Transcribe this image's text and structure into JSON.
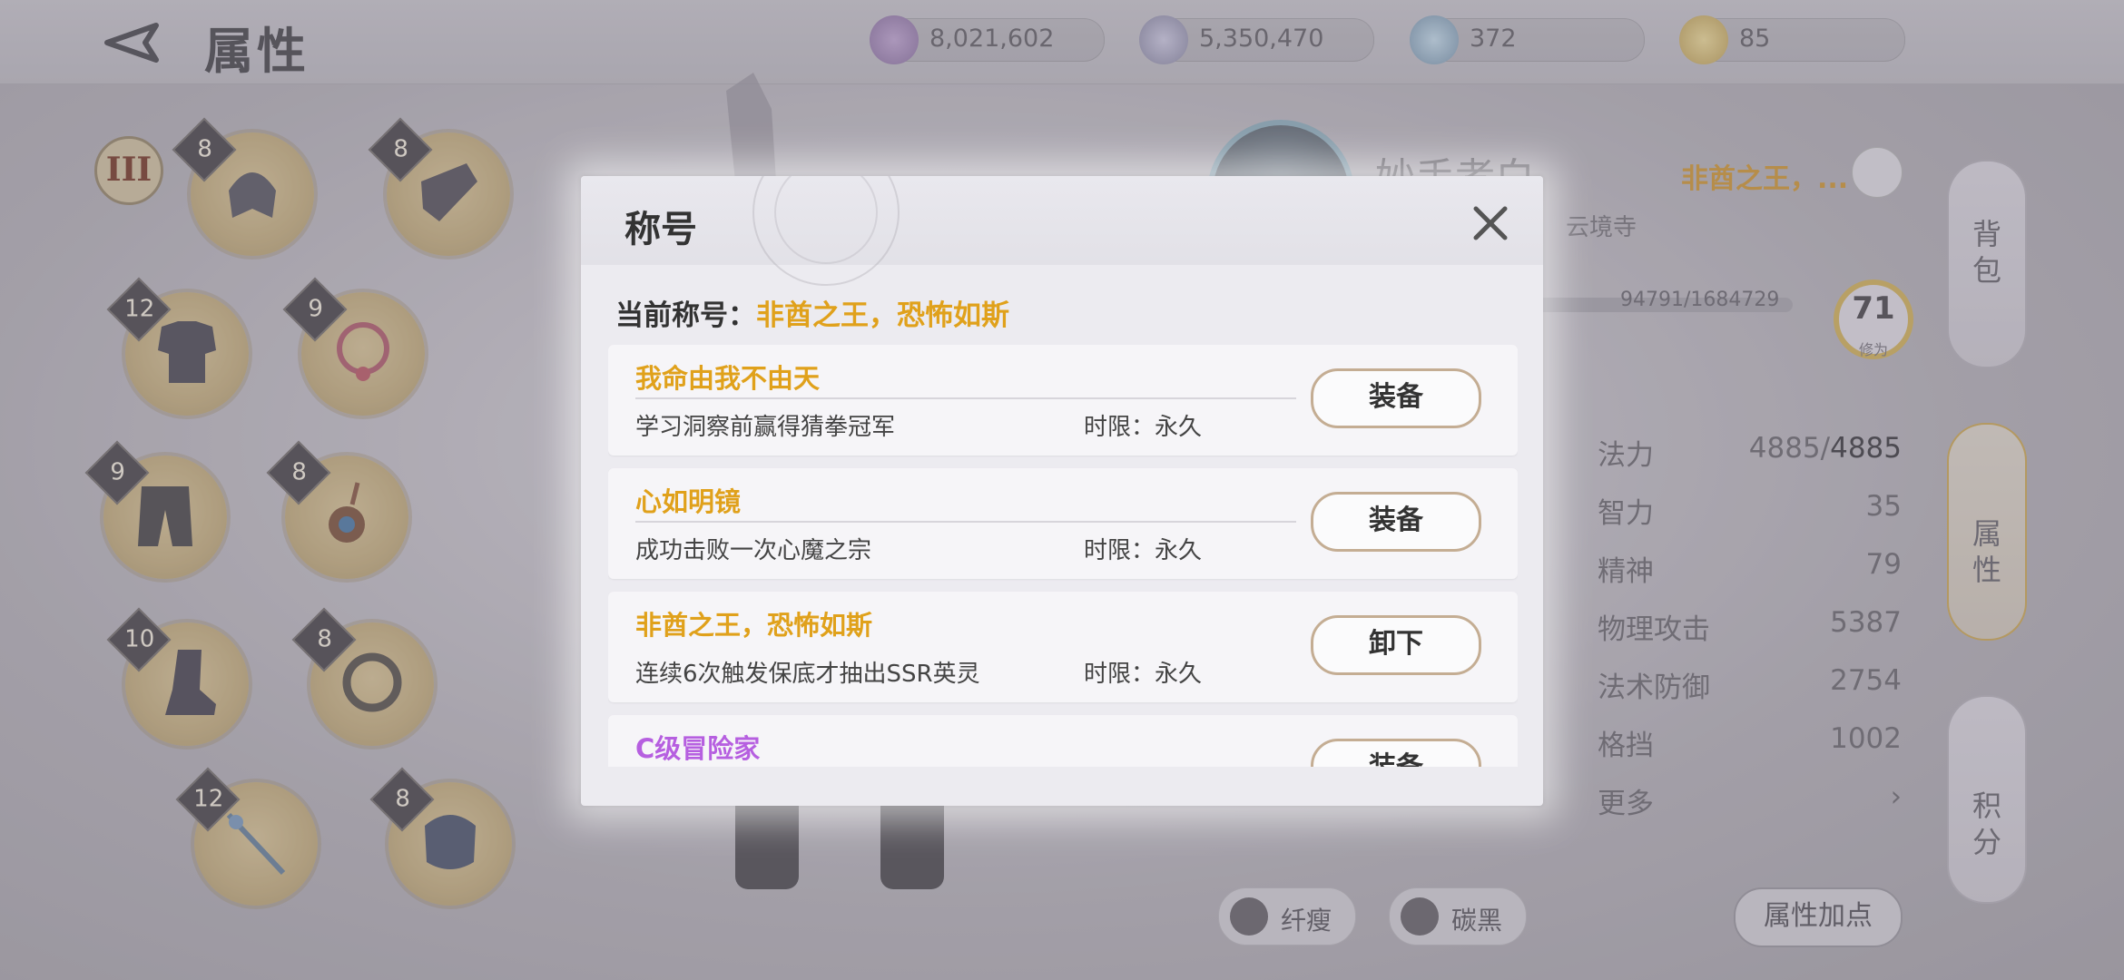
{
  "header": {
    "title": "属性"
  },
  "currencies": [
    {
      "icon": "purple-crystal-icon",
      "value": "8,021,602"
    },
    {
      "icon": "silver-coin-icon",
      "value": "5,350,470"
    },
    {
      "icon": "blue-gem-icon",
      "value": "372"
    },
    {
      "icon": "gold-medal-icon",
      "value": "85"
    }
  ],
  "equipment": {
    "tier": "III",
    "slots": [
      {
        "icon": "helmet-icon",
        "level": "8"
      },
      {
        "icon": "gauntlet-icon",
        "level": "8"
      },
      {
        "icon": "armor-icon",
        "level": "12"
      },
      {
        "icon": "necklace-icon",
        "level": "9"
      },
      {
        "icon": "pants-icon",
        "level": "9"
      },
      {
        "icon": "amulet-icon",
        "level": "8"
      },
      {
        "icon": "boots-icon",
        "level": "10"
      },
      {
        "icon": "ring-icon",
        "level": "8"
      },
      {
        "icon": "staff-icon",
        "level": "12"
      },
      {
        "icon": "shoulder-guard-icon",
        "level": "8"
      }
    ]
  },
  "character": {
    "name": "妙手孝白",
    "title_short": "非酋之王，...",
    "guild": "云境寺",
    "xp": "94791/1684729",
    "level": "71",
    "level_caption": "修为"
  },
  "stats": [
    {
      "name": "法力",
      "value": "4885/",
      "value_max": "4885"
    },
    {
      "name": "智力",
      "value": "35"
    },
    {
      "name": "精神",
      "value": "79"
    },
    {
      "name": "物理攻击",
      "value": "5387"
    },
    {
      "name": "法术防御",
      "value": "2754"
    },
    {
      "name": "格挡",
      "value": "1002"
    },
    {
      "name": "更多",
      "value": "›"
    }
  ],
  "side_tabs": [
    {
      "label": "背\n包",
      "icon": "backpack-icon"
    },
    {
      "label": "属\n性",
      "icon": "yin-yang-icon"
    },
    {
      "label": "积\n分",
      "icon": "medal-icon"
    }
  ],
  "bottom": {
    "chip1": "纤瘦",
    "chip2": "碳黑",
    "attr_add": "属性加点"
  },
  "modal": {
    "title": "称号",
    "current_label": "当前称号：",
    "current_value": "非酋之王，恐怖如斯",
    "limit_label": "时限：",
    "items": [
      {
        "name": "我命由我不由天",
        "desc": "学习洞察前赢得猜拳冠军",
        "limit": "永久",
        "action": "装备",
        "color": "#e0a11b"
      },
      {
        "name": "心如明镜",
        "desc": "成功击败一次心魔之宗",
        "limit": "永久",
        "action": "装备",
        "color": "#e0a11b"
      },
      {
        "name": "非酋之王，恐怖如斯",
        "desc": "连续6次触发保底才抽出SSR英灵",
        "limit": "永久",
        "action": "卸下",
        "color": "#e0a11b"
      },
      {
        "name": "C级冒险家",
        "desc": "",
        "limit": "",
        "action": "装备",
        "color": "#b65fe0"
      }
    ]
  }
}
